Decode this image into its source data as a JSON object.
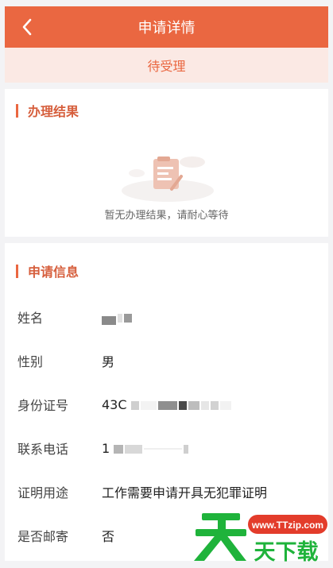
{
  "header": {
    "title": "申请详情"
  },
  "status": {
    "label": "待受理"
  },
  "result": {
    "section_title": "办理结果",
    "empty_text": "暂无办理结果，请耐心等待"
  },
  "info": {
    "section_title": "申请信息",
    "rows": [
      {
        "label": "姓名",
        "value": ""
      },
      {
        "label": "性别",
        "value": "男"
      },
      {
        "label": "身份证号",
        "value": "43C"
      },
      {
        "label": "联系电话",
        "value": "1"
      },
      {
        "label": "证明用途",
        "value": "工作需要申请开具无犯罪证明"
      },
      {
        "label": "是否邮寄",
        "value": "否"
      }
    ]
  },
  "watermark": {
    "main": "天下载",
    "url": "www.TTzip.com"
  },
  "colors": {
    "accent": "#ea6741",
    "status_bg": "#fbe9e4",
    "watermark_green": "#1fb33b",
    "watermark_red": "#e33c2b"
  }
}
